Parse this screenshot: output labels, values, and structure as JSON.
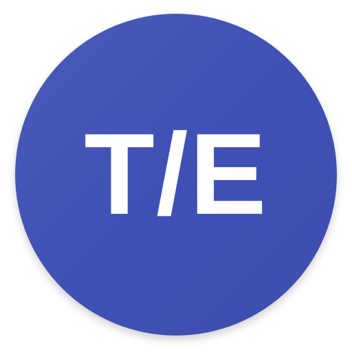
{
  "icon": {
    "label": "T/E",
    "background_color": "#3f51b5",
    "text_color": "#ffffff"
  }
}
